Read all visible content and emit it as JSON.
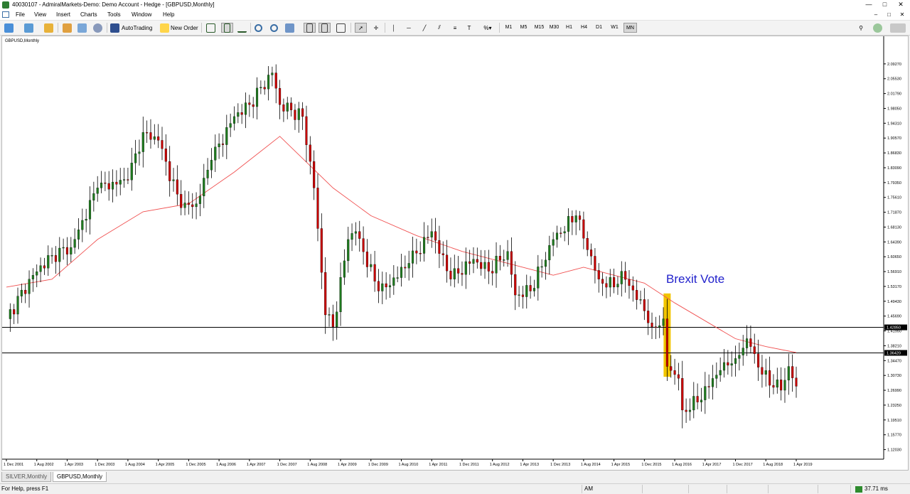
{
  "window": {
    "title": "40030107 - AdmiralMarkets-Demo: Demo Account - Hedge - [GBPUSD,Monthly]",
    "controls": [
      "—",
      "□",
      "✕"
    ]
  },
  "menu": {
    "items": [
      "File",
      "View",
      "Insert",
      "Charts",
      "Tools",
      "Window",
      "Help"
    ],
    "mdi_controls": [
      "–",
      "□",
      "✕"
    ]
  },
  "toolbar": {
    "autotrading_label": "AutoTrading",
    "new_order_label": "New Order",
    "timeframes": [
      "M1",
      "M5",
      "M15",
      "M30",
      "H1",
      "H4",
      "D1",
      "W1",
      "MN"
    ],
    "active_timeframe": "MN"
  },
  "chart": {
    "label": "GBPUSD,Monthly",
    "annotation": "Brexit Vote",
    "colors": {
      "bull": "#1e7a1e",
      "bear": "#c80000",
      "ma": "#f05050",
      "annotation": "#2222cc",
      "highlight": "#f2c500",
      "hline": "#000000"
    }
  },
  "chart_data": {
    "type": "candlestick",
    "symbol": "GBPUSD",
    "timeframe": "Monthly",
    "overlay": "moving average (red line)",
    "y_ticks": [
      "2.09270",
      "2.05530",
      "2.01790",
      "1.98050",
      "1.94310",
      "1.90570",
      "1.86830",
      "1.83090",
      "1.79350",
      "1.75610",
      "1.71870",
      "1.68130",
      "1.64390",
      "1.60650",
      "1.56910",
      "1.53170",
      "1.49430",
      "1.45690",
      "1.41950",
      "1.38210",
      "1.34470",
      "1.30730",
      "1.26990",
      "1.23250",
      "1.19510",
      "1.15770",
      "1.12030"
    ],
    "ylim": [
      1.1016,
      2.1301
    ],
    "x_ticks": [
      "1 Dec 2001",
      "1 Aug 2002",
      "1 Apr 2003",
      "1 Dec 2003",
      "1 Aug 2004",
      "1 Apr 2005",
      "1 Dec 2005",
      "1 Aug 2006",
      "1 Apr 2007",
      "1 Dec 2007",
      "1 Aug 2008",
      "1 Apr 2009",
      "1 Dec 2009",
      "1 Aug 2010",
      "1 Apr 2011",
      "1 Dec 2011",
      "1 Aug 2012",
      "1 Apr 2013",
      "1 Dec 2013",
      "1 Aug 2014",
      "1 Apr 2015",
      "1 Dec 2015",
      "1 Aug 2016",
      "1 Apr 2017",
      "1 Dec 2017",
      "1 Aug 2018",
      "1 Apr 2019"
    ],
    "horizontal_levels": [
      {
        "value": 1.4285,
        "label": "1.42850"
      },
      {
        "value": 1.3642,
        "label": "1.36420"
      }
    ],
    "highlight": {
      "label": "Brexit Vote",
      "month": "Jun 2016"
    },
    "keypoints": [
      {
        "month": "Dec 2001",
        "close": 1.45
      },
      {
        "month": "Jul 2002",
        "close": 1.56
      },
      {
        "month": "Dec 2002",
        "close": 1.61
      },
      {
        "month": "May 2003",
        "close": 1.63
      },
      {
        "month": "Dec 2003",
        "close": 1.78
      },
      {
        "month": "Aug 2004",
        "close": 1.8
      },
      {
        "month": "Dec 2004",
        "close": 1.92
      },
      {
        "month": "Apr 2005",
        "close": 1.9
      },
      {
        "month": "Oct 2005",
        "close": 1.73
      },
      {
        "month": "Feb 2006",
        "close": 1.74
      },
      {
        "month": "Jun 2006",
        "close": 1.85
      },
      {
        "month": "Dec 2006",
        "close": 1.96
      },
      {
        "month": "Apr 2007",
        "close": 1.99
      },
      {
        "month": "Oct 2007",
        "close": 2.07
      },
      {
        "month": "Dec 2007",
        "close": 1.99
      },
      {
        "month": "Jun 2008",
        "close": 1.96
      },
      {
        "month": "Sep 2008",
        "close": 1.78
      },
      {
        "month": "Dec 2008",
        "close": 1.46
      },
      {
        "month": "Feb 2009",
        "close": 1.43
      },
      {
        "month": "Jun 2009",
        "close": 1.65
      },
      {
        "month": "Aug 2009",
        "close": 1.67
      },
      {
        "month": "Feb 2010",
        "close": 1.52
      },
      {
        "month": "Apr 2010",
        "close": 1.53
      },
      {
        "month": "Oct 2010",
        "close": 1.59
      },
      {
        "month": "Apr 2011",
        "close": 1.67
      },
      {
        "month": "Sep 2011",
        "close": 1.55
      },
      {
        "month": "Mar 2012",
        "close": 1.6
      },
      {
        "month": "Jul 2012",
        "close": 1.57
      },
      {
        "month": "Dec 2012",
        "close": 1.62
      },
      {
        "month": "Feb 2013",
        "close": 1.51
      },
      {
        "month": "Jun 2013",
        "close": 1.52
      },
      {
        "month": "Dec 2013",
        "close": 1.65
      },
      {
        "month": "Jun 2014",
        "close": 1.71
      },
      {
        "month": "Dec 2014",
        "close": 1.55
      },
      {
        "month": "Apr 2015",
        "close": 1.53
      },
      {
        "month": "Jun 2015",
        "close": 1.57
      },
      {
        "month": "Dec 2015",
        "close": 1.47
      },
      {
        "month": "Feb 2016",
        "close": 1.43
      },
      {
        "month": "May 2016",
        "close": 1.45
      },
      {
        "month": "Jun 2016",
        "close": 1.33
      },
      {
        "month": "Sep 2016",
        "close": 1.3
      },
      {
        "month": "Oct 2016",
        "close": 1.22
      },
      {
        "month": "Feb 2017",
        "close": 1.24
      },
      {
        "month": "Sep 2017",
        "close": 1.34
      },
      {
        "month": "Dec 2017",
        "close": 1.35
      },
      {
        "month": "Mar 2018",
        "close": 1.4
      },
      {
        "month": "Apr 2018",
        "close": 1.38
      },
      {
        "month": "Jul 2018",
        "close": 1.31
      },
      {
        "month": "Dec 2018",
        "close": 1.27
      },
      {
        "month": "Feb 2019",
        "close": 1.33
      },
      {
        "month": "Apr 2019",
        "close": 1.28
      }
    ],
    "moving_average": [
      {
        "month": "Dec 2001",
        "value": 1.53
      },
      {
        "month": "Dec 2002",
        "value": 1.55
      },
      {
        "month": "Dec 2003",
        "value": 1.65
      },
      {
        "month": "Dec 2004",
        "value": 1.72
      },
      {
        "month": "Dec 2005",
        "value": 1.74
      },
      {
        "month": "Dec 2006",
        "value": 1.82
      },
      {
        "month": "Dec 2007",
        "value": 1.91
      },
      {
        "month": "Feb 2009",
        "value": 1.78
      },
      {
        "month": "Dec 2009",
        "value": 1.71
      },
      {
        "month": "Dec 2010",
        "value": 1.66
      },
      {
        "month": "Dec 2011",
        "value": 1.62
      },
      {
        "month": "Dec 2012",
        "value": 1.59
      },
      {
        "month": "Dec 2013",
        "value": 1.56
      },
      {
        "month": "Aug 2014",
        "value": 1.58
      },
      {
        "month": "Apr 2015",
        "value": 1.56
      },
      {
        "month": "Dec 2015",
        "value": 1.54
      },
      {
        "month": "Aug 2016",
        "value": 1.49
      },
      {
        "month": "Dec 2017",
        "value": 1.4
      },
      {
        "month": "Aug 2018",
        "value": 1.38
      },
      {
        "month": "Apr 2019",
        "value": 1.365
      }
    ]
  },
  "tabs": [
    "SILVER,Monthly",
    "GBPUSD,Monthly"
  ],
  "active_tab": "GBPUSD,Monthly",
  "status": {
    "help": "For Help, press F1",
    "profile": "AM",
    "ping": "37.71 ms"
  }
}
